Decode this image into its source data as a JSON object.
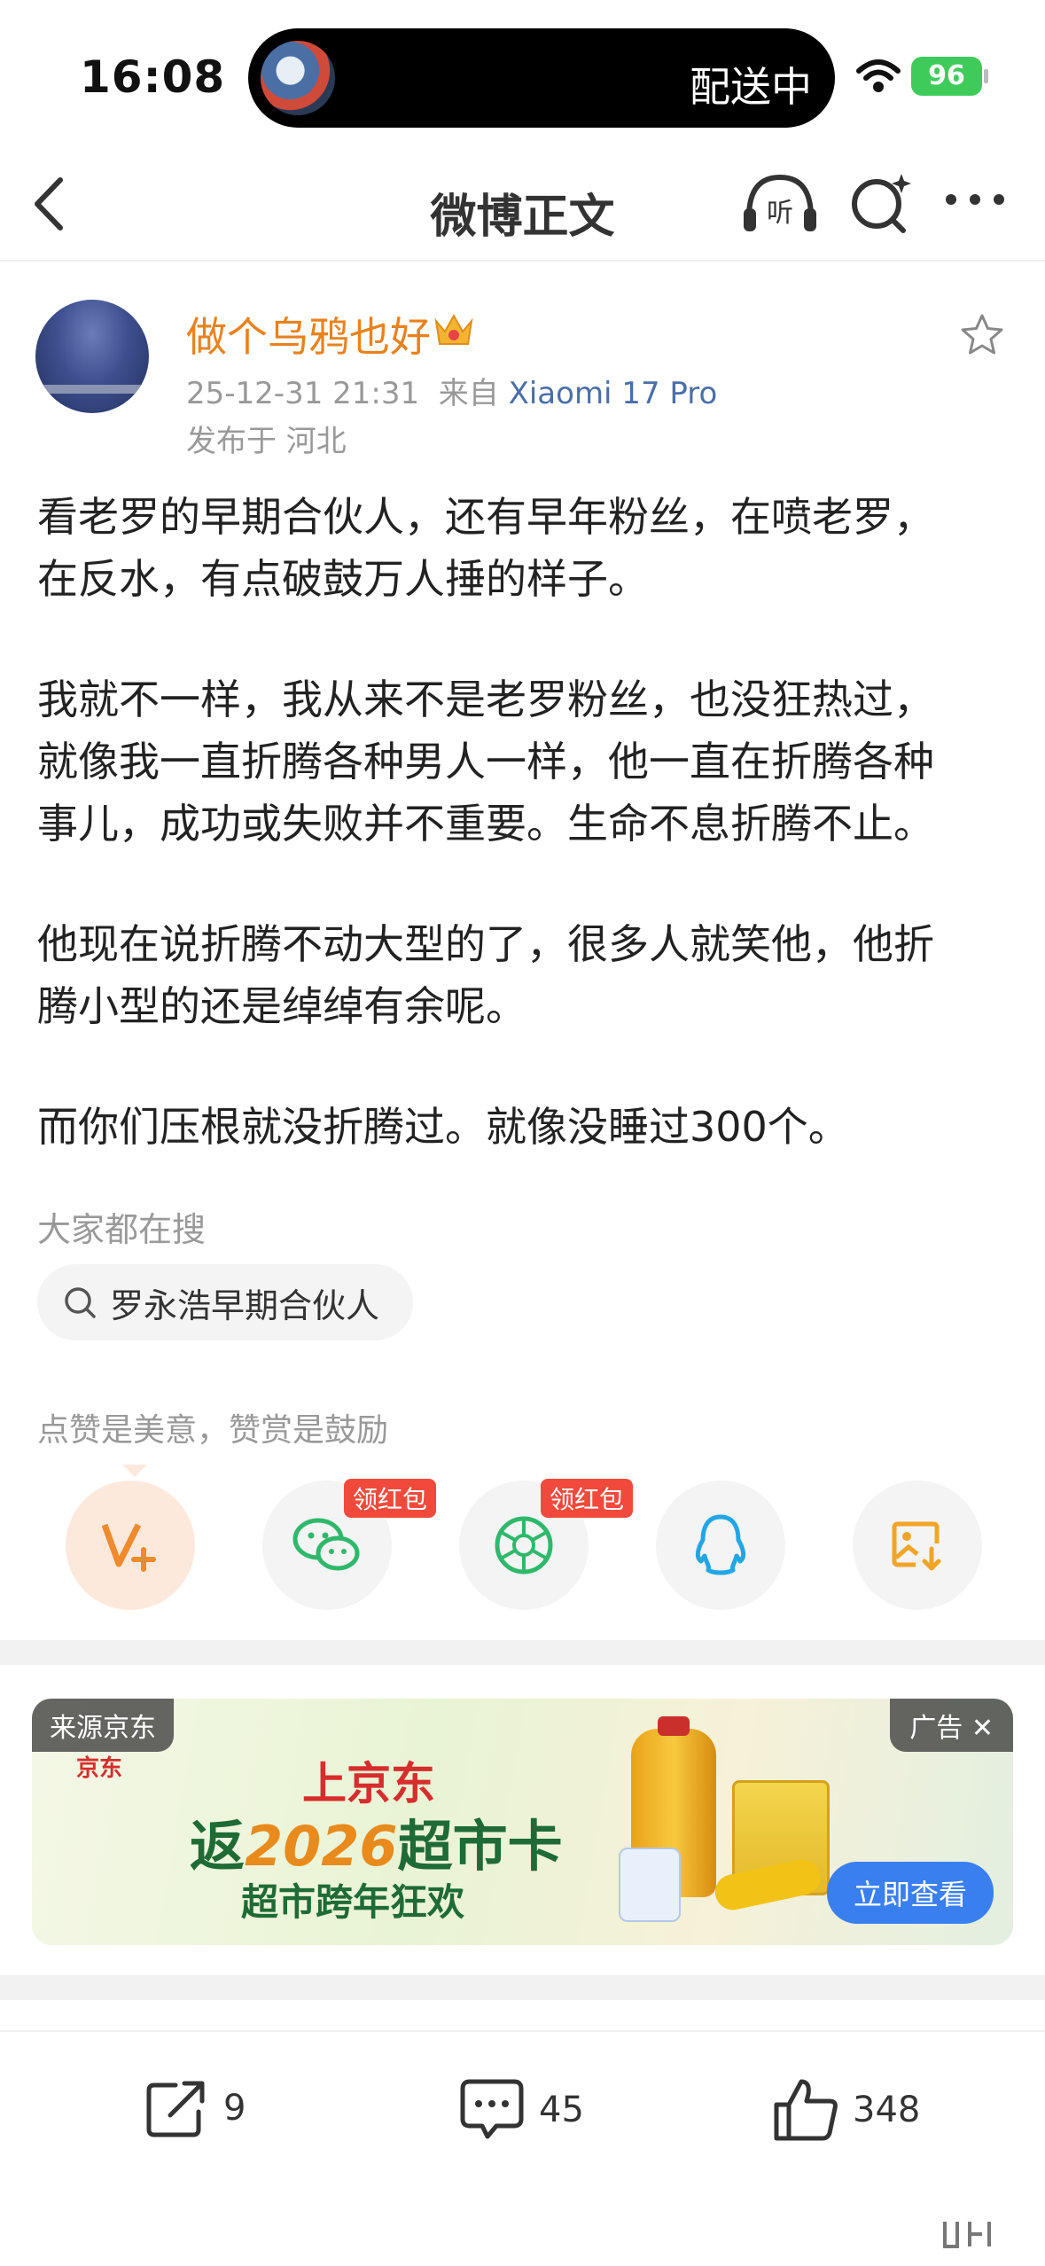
{
  "status_bar": {
    "time": "16:08",
    "live_activity_text": "配送中",
    "battery_level": "96"
  },
  "nav": {
    "title": "微博正文",
    "listen_label": "听"
  },
  "post": {
    "author": "做个乌鸦也好",
    "timestamp": "25-12-31 21:31",
    "source_prefix": "来自",
    "device": "Xiaomi 17 Pro",
    "location": "发布于 河北",
    "paragraphs": [
      [
        "看老罗的早期合伙人，还有早年粉丝，在喷老罗，",
        "在反水，有点破鼓万人捶的样子。"
      ],
      [
        "我就不一样，我从来不是老罗粉丝，也没狂热过，",
        "就像我一直折腾各种男人一样，他一直在折腾各种",
        "事儿，成功或失败并不重要。生命不息折腾不止。"
      ],
      [
        "他现在说折腾不动大型的了，很多人就笑他，他折",
        "腾小型的还是绰绰有余呢。"
      ],
      [
        "而你们压根就没折腾过。就像没睡过300个。"
      ]
    ]
  },
  "search": {
    "hint": "大家都在搜",
    "chip": "罗永浩早期合伙人"
  },
  "reward": {
    "hint": "点赞是美意，赞赏是鼓励",
    "share_targets": [
      {
        "name": "reward-vplus",
        "icon": "v-plus-icon",
        "badge": ""
      },
      {
        "name": "share-wechat",
        "icon": "wechat-icon",
        "badge": "领红包"
      },
      {
        "name": "share-moments",
        "icon": "moments-icon",
        "badge": "领红包"
      },
      {
        "name": "share-qq",
        "icon": "qq-icon",
        "badge": ""
      },
      {
        "name": "save-image",
        "icon": "save-image-icon",
        "badge": ""
      }
    ]
  },
  "ad": {
    "source": "来源京东",
    "tag": "广告",
    "brand": "京东",
    "line1": "上京东",
    "line2_prefix": "返",
    "line2_year": "2026",
    "line2_suffix": "超市卡",
    "line3": "超市跨年狂欢",
    "cta": "立即查看"
  },
  "actions": {
    "reposts": "9",
    "comments": "45",
    "likes": "348"
  },
  "colors": {
    "username": "#e8821e",
    "device_link": "#4a6fa8",
    "badge": "#f14a3c",
    "cta": "#3a7ff0"
  }
}
